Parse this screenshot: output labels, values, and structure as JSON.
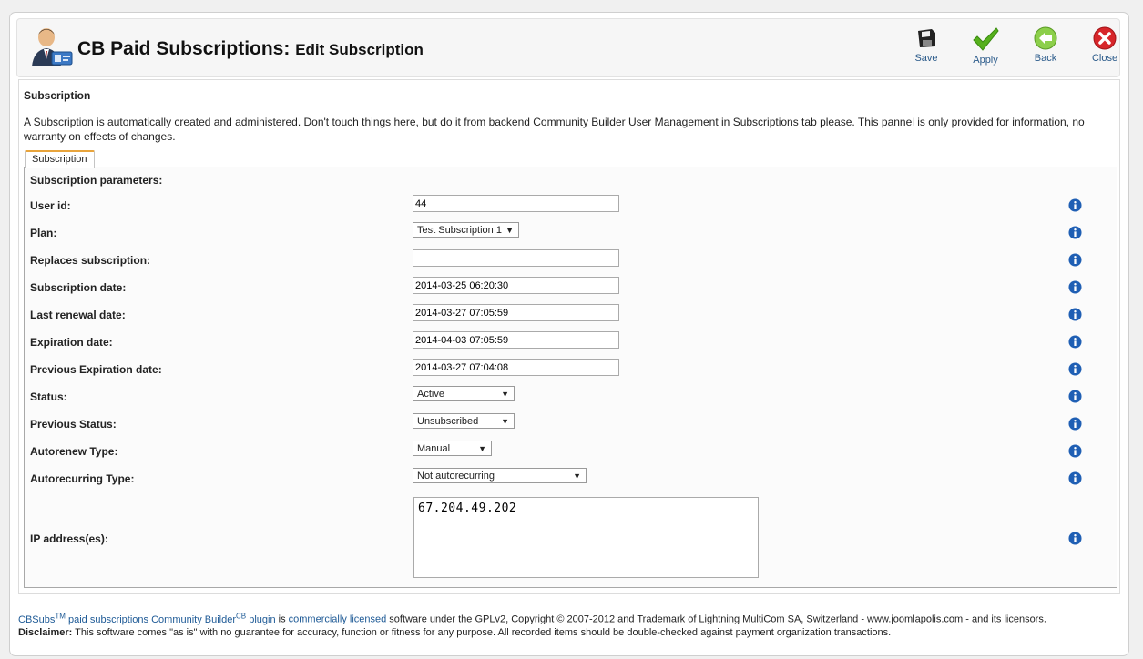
{
  "header": {
    "title": "CB Paid Subscriptions:",
    "subtitle": "Edit Subscription",
    "logo_icon": "user-admin-icon"
  },
  "toolbar": [
    {
      "label": "Save",
      "icon": "floppy-disk-icon"
    },
    {
      "label": "Apply",
      "icon": "checkmark-icon"
    },
    {
      "label": "Back",
      "icon": "back-arrow-icon"
    },
    {
      "label": "Close",
      "icon": "close-icon"
    }
  ],
  "section": {
    "title": "Subscription",
    "description": "A Subscription is automatically created and administered. Don't touch things here, but do it from backend Community Builder User Management in Subscriptions tab please. This pannel is only provided for information, no warranty on effects of changes."
  },
  "tab": {
    "label": "Subscription"
  },
  "params": {
    "title": "Subscription parameters:",
    "fields": [
      {
        "label": "User id:",
        "value": "44"
      },
      {
        "label": "Plan:",
        "value": "Test Subscription 1"
      },
      {
        "label": "Replaces subscription:",
        "value": ""
      },
      {
        "label": "Subscription date:",
        "value": "2014-03-25 06:20:30"
      },
      {
        "label": "Last renewal date:",
        "value": "2014-03-27 07:05:59"
      },
      {
        "label": "Expiration date:",
        "value": "2014-04-03 07:05:59"
      },
      {
        "label": "Previous Expiration date:",
        "value": "2014-03-27 07:04:08"
      },
      {
        "label": "Status:",
        "value": "Active"
      },
      {
        "label": "Previous Status:",
        "value": "Unsubscribed"
      },
      {
        "label": "Autorenew Type:",
        "value": "Manual"
      },
      {
        "label": "Autorecurring Type:",
        "value": "Not autorecurring"
      },
      {
        "label": "IP address(es):",
        "value": "67.204.49.202"
      }
    ]
  },
  "footer": {
    "cbsubs": "CBSubs",
    "tm": "TM",
    "paid_link": "paid subscriptions Community Builder",
    "cb_sup": "CB",
    "plugin": "plugin",
    "is": "is",
    "licensed_link": "commercially licensed",
    "rest": "software under the GPLv2, Copyright © 2007-2012 and Trademark of Lightning MultiCom SA, Switzerland - www.joomlapolis.com - and its licensors.",
    "disclaimer_label": "Disclaimer:",
    "disclaimer": "This software comes \"as is\" with no guarantee for accuracy, function or fitness for any purpose. All recorded items should be double-checked against payment organization transactions."
  },
  "colors": {
    "link": "#1e5a96",
    "tab_accent": "#e8a43c",
    "info_icon": "#1f5fb4",
    "apply_green": "#56b01c",
    "close_red": "#d7262a"
  }
}
